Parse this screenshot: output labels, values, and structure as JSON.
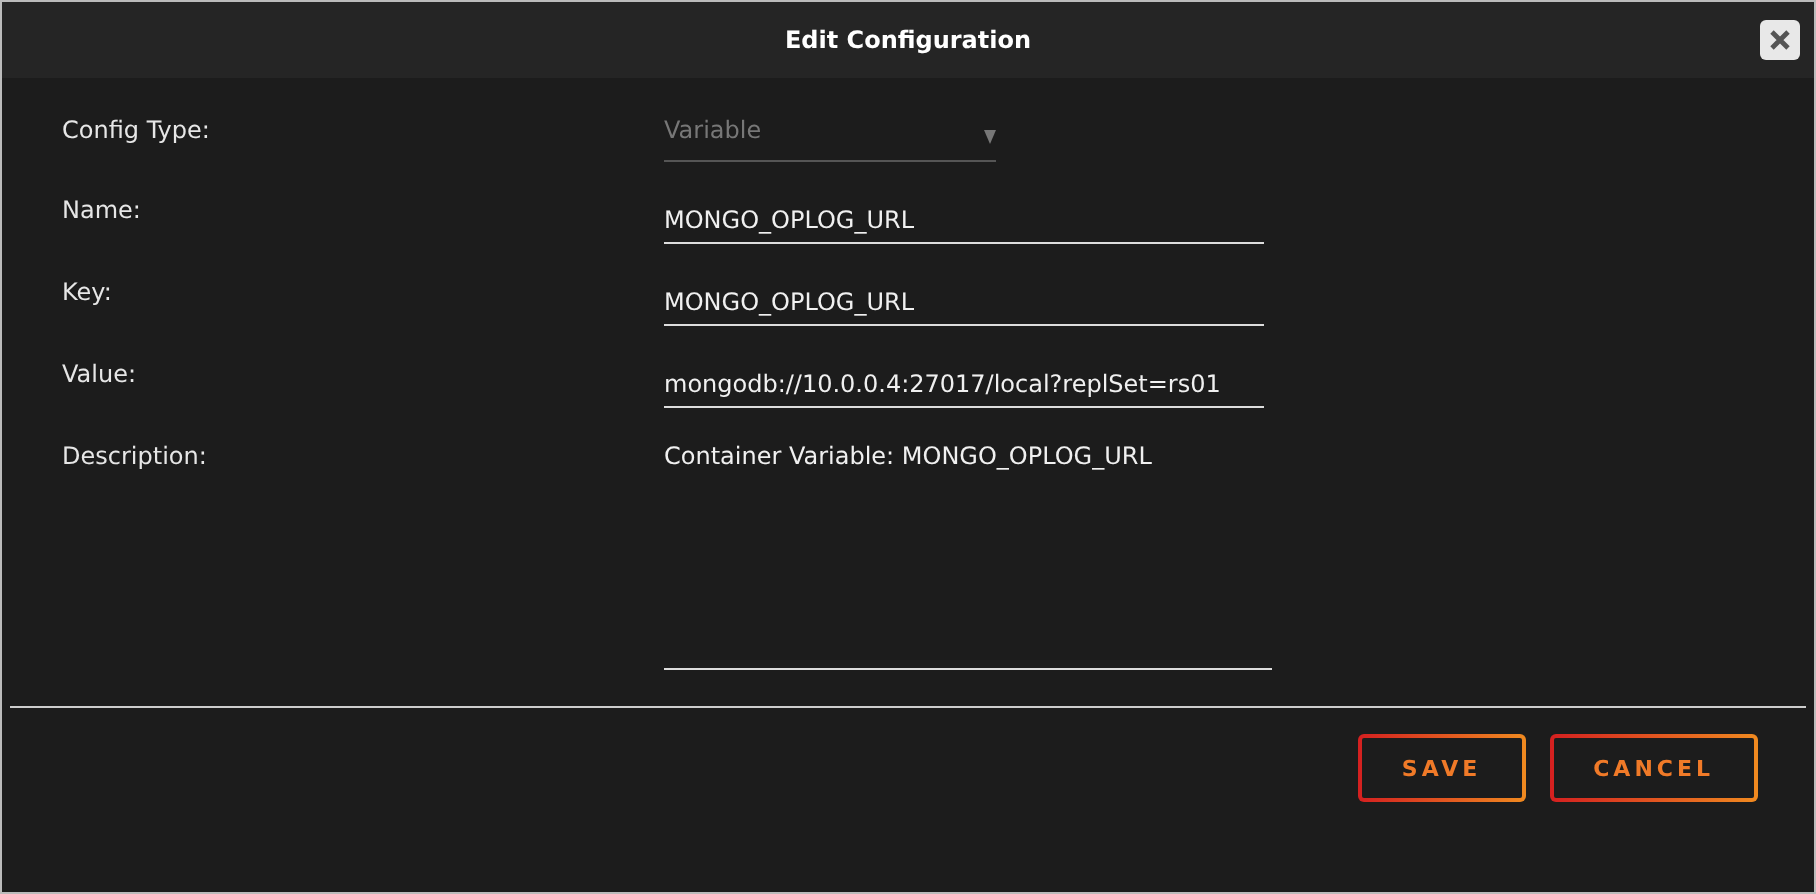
{
  "window": {
    "title": "Edit Configuration"
  },
  "fields": [
    {
      "kind": "select",
      "label": "Config Type:",
      "value": "Variable",
      "disabled": true
    },
    {
      "kind": "input",
      "label": "Name:",
      "value": "MONGO_OPLOG_URL",
      "disabled": false
    },
    {
      "kind": "input",
      "label": "Key:",
      "value": "MONGO_OPLOG_URL",
      "disabled": false
    },
    {
      "kind": "input",
      "label": "Value:",
      "value": "mongodb://10.0.0.4:27017/local?replSet=rs01",
      "disabled": false
    },
    {
      "kind": "textarea",
      "label": "Description:",
      "value": "Container Variable: MONGO_OPLOG_URL",
      "disabled": false
    }
  ],
  "buttons": [
    "SAVE",
    "CANCEL"
  ]
}
